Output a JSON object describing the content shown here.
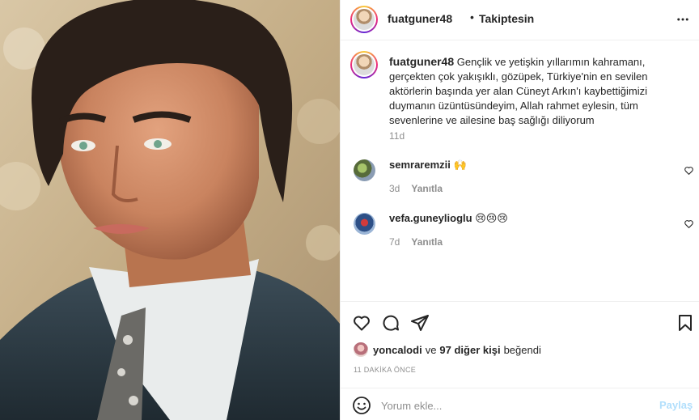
{
  "header": {
    "username": "fuatguner48",
    "separator": "•",
    "follow_status": "Takiptesin",
    "more_icon": "more-horizontal-icon"
  },
  "caption": {
    "username": "fuatguner48",
    "text": "Gençlik ve yetişkin yıllarımın kahramanı, gerçekten çok yakışıklı, gözüpek, Türkiye'nin en sevilen aktörlerin başında yer alan Cüneyt Arkın'ı kaybettiğimizi duymanın üzüntüsündeyim, Allah rahmet eylesin, tüm sevenlerine ve ailesine baş sağlığı diliyorum",
    "time": "11d"
  },
  "comments": [
    {
      "username": "semraremzii",
      "text": "🙌",
      "time": "3d",
      "reply_label": "Yanıtla"
    },
    {
      "username": "vefa.guneylioglu",
      "text": "😢😢😢",
      "time": "7d",
      "reply_label": "Yanıtla"
    }
  ],
  "actions": {
    "like_icon": "heart-icon",
    "comment_icon": "comment-bubble-icon",
    "share_icon": "paper-plane-icon",
    "save_icon": "bookmark-icon"
  },
  "likes": {
    "user": "yoncalodi",
    "connector": "ve",
    "others": "97 diğer kişi",
    "suffix": "beğendi"
  },
  "post_time": "11 DAKİKA ÖNCE",
  "comment_box": {
    "placeholder": "Yorum ekle...",
    "post_label": "Paylaş",
    "emoji_icon": "smiley-icon"
  },
  "colors": {
    "text": "#262626",
    "muted": "#8e8e8e",
    "border": "#efefef",
    "post_button_disabled": "#b2dffc"
  }
}
